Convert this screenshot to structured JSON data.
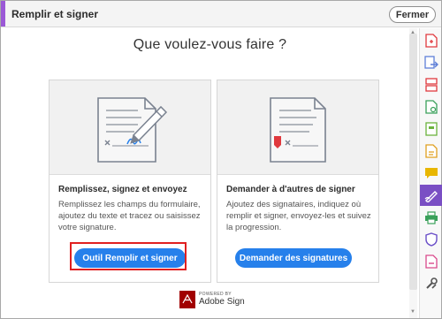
{
  "header": {
    "title": "Remplir et signer",
    "close_label": "Fermer"
  },
  "main": {
    "title": "Que voulez-vous faire ?"
  },
  "cards": [
    {
      "heading": "Remplissez, signez et envoyez",
      "description": "Remplissez les champs du formulaire, ajoutez du texte et tracez ou saisissez votre signature.",
      "button_label": "Outil Remplir et signer",
      "icon": "fill-and-sign-illustration"
    },
    {
      "heading": "Demander à d'autres de signer",
      "description": "Ajoutez des signataires, indiquez où remplir et signer, envoyez-les et suivez la progression.",
      "button_label": "Demander des signatures",
      "icon": "request-signatures-illustration"
    }
  ],
  "powered_by": {
    "small_text": "POWERED BY",
    "brand": "Adobe Sign"
  },
  "toolbar": {
    "tools": [
      {
        "name": "create-pdf-icon",
        "color": "#e0393e"
      },
      {
        "name": "export-pdf-icon",
        "color": "#5f7fd8"
      },
      {
        "name": "organize-pages-icon",
        "color": "#e0393e"
      },
      {
        "name": "edit-pdf-icon",
        "color": "#3aa05a"
      },
      {
        "name": "prepare-form-icon",
        "color": "#6cb33e"
      },
      {
        "name": "export-file-icon",
        "color": "#e0a020"
      },
      {
        "name": "comment-icon",
        "color": "#e8b600"
      },
      {
        "name": "fill-and-sign-icon",
        "color": "#ffffff",
        "active": true
      },
      {
        "name": "print-icon",
        "color": "#3aa05a"
      },
      {
        "name": "protect-icon",
        "color": "#6a4fc8"
      },
      {
        "name": "acrobat-pdf-icon",
        "color": "#d94a8c"
      },
      {
        "name": "more-tools-icon",
        "color": "#555555"
      }
    ]
  },
  "colors": {
    "accent": "#9b59d6",
    "primary_button": "#2680eb",
    "highlight": "#e02020"
  }
}
